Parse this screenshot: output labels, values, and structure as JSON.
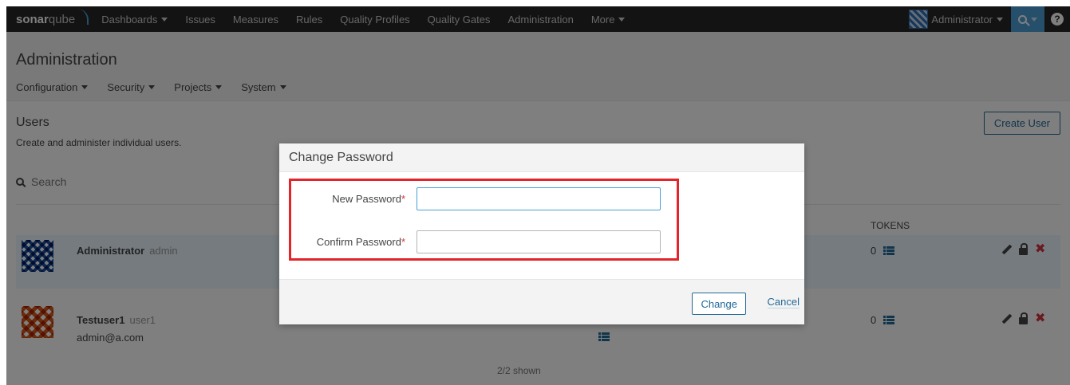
{
  "navbar": {
    "logo_bold": "sonar",
    "logo_light": "qube",
    "items": [
      "Dashboards",
      "Issues",
      "Measures",
      "Rules",
      "Quality Profiles",
      "Quality Gates",
      "Administration",
      "More"
    ],
    "user": "Administrator",
    "help": "?"
  },
  "header": {
    "title": "Administration",
    "subnav": [
      "Configuration",
      "Security",
      "Projects",
      "System"
    ]
  },
  "users": {
    "title": "Users",
    "description": "Create and administer individual users.",
    "create_label": "Create User",
    "search_placeholder": "Search",
    "tokens_header": "TOKENS",
    "rows": [
      {
        "name": "Administrator",
        "login": "admin",
        "email": "",
        "tokens": "0"
      },
      {
        "name": "Testuser1",
        "login": "user1",
        "email": "admin@a.com",
        "tokens": "0"
      }
    ],
    "shown": "2/2 shown"
  },
  "modal": {
    "title": "Change Password",
    "new_password_label": "New Password",
    "confirm_password_label": "Confirm Password",
    "required_mark": "*",
    "new_password_value": "",
    "confirm_password_value": "",
    "change_label": "Change",
    "cancel_label": "Cancel",
    "highlight_color": "#e3242b"
  },
  "colors": {
    "navbar_bg": "#262626",
    "accent": "#4b9fd5",
    "link": "#236a97",
    "danger": "#d4333f"
  }
}
